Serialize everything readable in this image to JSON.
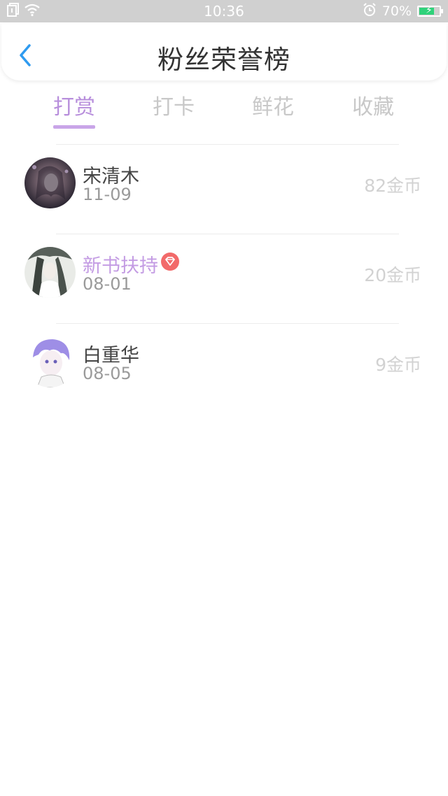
{
  "status_bar": {
    "time": "10:36",
    "battery_percent": "70%",
    "battery_level": 0.7
  },
  "nav": {
    "title": "粉丝荣誉榜"
  },
  "tabs": [
    {
      "label": "打赏",
      "active": true
    },
    {
      "label": "打卡",
      "active": false
    },
    {
      "label": "鲜花",
      "active": false
    },
    {
      "label": "收藏",
      "active": false
    }
  ],
  "list": [
    {
      "name": "宋清木",
      "date": "11-09",
      "amount": "82金币",
      "vip": false
    },
    {
      "name": "新书扶持",
      "date": "08-01",
      "amount": "20金币",
      "vip": true
    },
    {
      "name": "白重华",
      "date": "08-05",
      "amount": "9金币",
      "vip": false
    }
  ],
  "colors": {
    "accent": "#b88fdc",
    "status_bar_bg": "#d0d0d0",
    "vip_badge": "#f26a6a",
    "back_arrow": "#2f9bf0"
  }
}
